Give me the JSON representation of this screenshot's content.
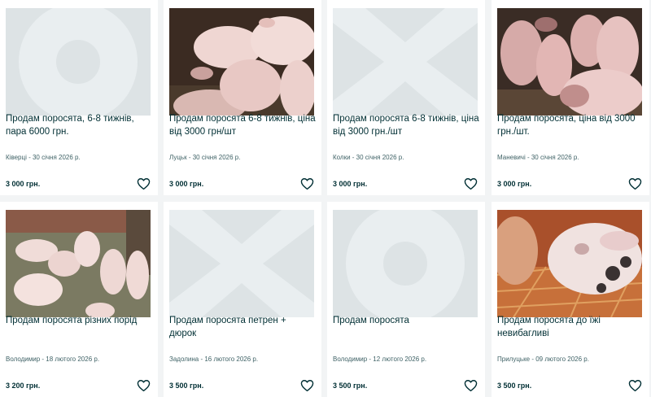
{
  "colors": {
    "page_background": "#f2f4f5",
    "card_background": "#ffffff",
    "title_text": "#002f34",
    "meta_text": "#406367",
    "placeholder_background": "#dde3e5",
    "placeholder_glyph": "#e9eef0"
  },
  "favorite_icon": "heart-outline-icon",
  "listings": [
    {
      "title": "Продам поросята, 6-8 тижнів, пара 6000 грн.",
      "meta": "Ківерці - 30 січня 2026 р.",
      "price": "3 000 грн.",
      "image": "placeholder-circle"
    },
    {
      "title": "Продам поросята 6-8 тижнів, ціна від 3000 грн/шт",
      "meta": "Луцьк - 30 січня 2026 р.",
      "price": "3 000 грн.",
      "image": "photo-piglets-closeup"
    },
    {
      "title": "Продам поросята 6-8 тижнів, ціна від 3000 грн./шт",
      "meta": "Колки - 30 січня 2026 р.",
      "price": "3 000 грн.",
      "image": "placeholder-cross"
    },
    {
      "title": "Продам поросята, ціна від 3000 грн./шт.",
      "meta": "Маневичі - 30 січня 2026 р.",
      "price": "3 000 грн.",
      "image": "photo-piglets-group"
    },
    {
      "title": "Продам поросята різних порід",
      "meta": "Володимир - 18 лютого 2026 р.",
      "price": "3 200 грн.",
      "image": "photo-piglets-yard"
    },
    {
      "title": "Продам поросята петрен + дюрок",
      "meta": "Задолина - 16 лютого 2026 р.",
      "price": "3 500 грн.",
      "image": "placeholder-cross"
    },
    {
      "title": "Продам поросята",
      "meta": "Володимир - 12 лютого 2026 р.",
      "price": "3 500 грн.",
      "image": "placeholder-circle"
    },
    {
      "title": "Продам поросята до їжі невибагливі",
      "meta": "Прилуцьке - 09 лютого 2026 р.",
      "price": "3 500 грн.",
      "image": "photo-spotted-piglet"
    }
  ]
}
